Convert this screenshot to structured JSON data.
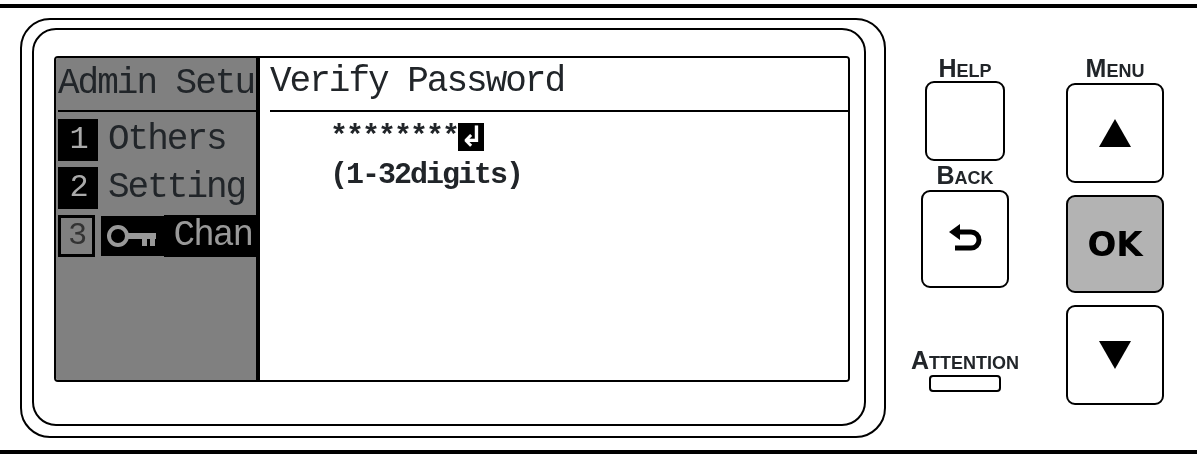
{
  "lcd": {
    "menu": {
      "title": "Admin Setu",
      "items": [
        {
          "kind": "plain",
          "number": "1",
          "label": "Others",
          "selected": false
        },
        {
          "kind": "plain",
          "number": "2",
          "label": "Setting",
          "selected": false
        },
        {
          "kind": "keyed",
          "number": "3",
          "label": "Chan",
          "selected": true
        }
      ]
    },
    "dialog": {
      "title": "Verify Password",
      "value": "********",
      "cursor": "↲",
      "hint": "(1-32digits)"
    }
  },
  "keys": {
    "left": [
      {
        "kind": "label",
        "text": "Help"
      },
      {
        "kind": "blank"
      },
      {
        "kind": "label",
        "text": "Back"
      },
      {
        "kind": "back"
      },
      {
        "kind": "label",
        "text": "Attention"
      },
      {
        "kind": "lamp"
      }
    ],
    "right": [
      {
        "kind": "label",
        "text": "Menu"
      },
      {
        "kind": "up"
      },
      {
        "kind": "ok",
        "text": "OK"
      },
      {
        "kind": "down"
      }
    ]
  }
}
